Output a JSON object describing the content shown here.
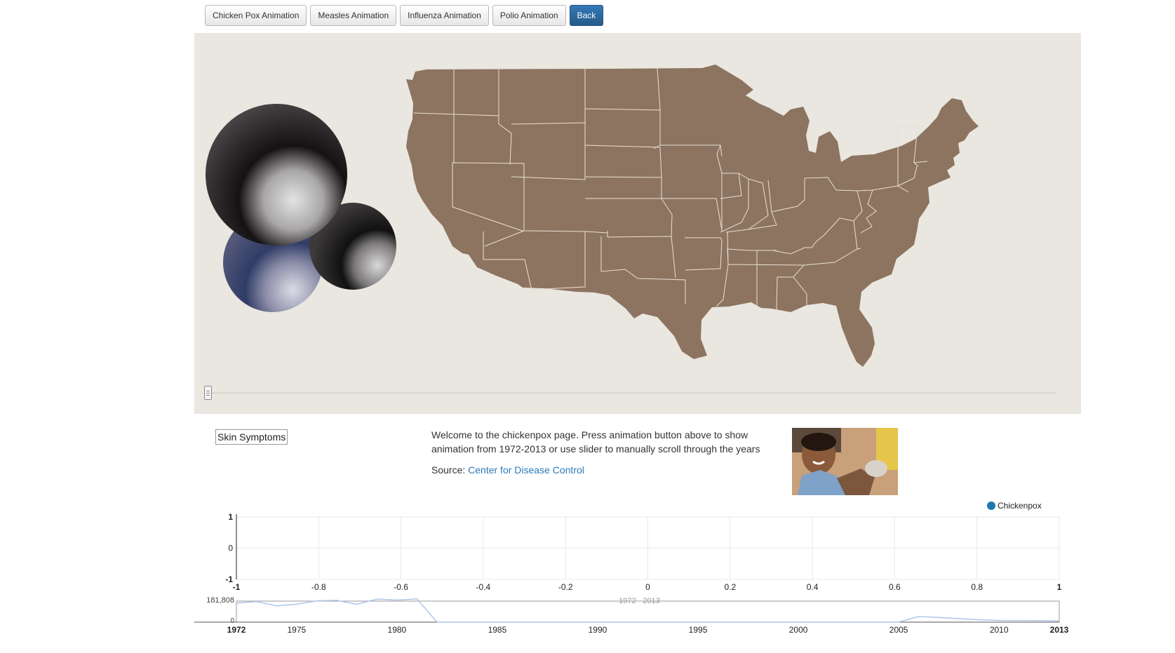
{
  "toolbar": {
    "buttons": [
      {
        "label": "Chicken Pox Animation"
      },
      {
        "label": "Measles Animation"
      },
      {
        "label": "Influenza Animation"
      },
      {
        "label": "Polio Animation"
      },
      {
        "label": "Back"
      }
    ]
  },
  "map": {
    "background": "#e9e7df",
    "land_color": "#8d7460",
    "border_color": "#e8e0d6",
    "slider_value": 0
  },
  "info": {
    "symptoms_button": "Skin Symptoms",
    "welcome_text": "Welcome to the chickenpox page. Press animation button above to show animation from 1972-2013 or use slider to manually scroll through the years",
    "source_label": "Source:",
    "source_link": "Center for Disease Control"
  },
  "chart_data": [
    {
      "type": "line",
      "legend": [
        "Chickenpox"
      ],
      "legend_color": "#1f77b4",
      "legend_position": "top-right",
      "x_ticks": [
        "-1",
        "-0.8",
        "-0.6",
        "-0.4",
        "-0.2",
        "0",
        "0.2",
        "0.4",
        "0.6",
        "0.8",
        "1"
      ],
      "y_ticks": [
        "1",
        "0",
        "-1"
      ],
      "xlim": [
        -1,
        1
      ],
      "ylim": [
        -1,
        1
      ],
      "grid": true,
      "series": [
        {
          "name": "Chickenpox",
          "x": [],
          "y": []
        }
      ]
    },
    {
      "type": "area",
      "role": "overview",
      "range_label": "1972 - 2013",
      "y_max_label": "181,808",
      "y_min_label": "0",
      "xlim": [
        1972,
        2013
      ],
      "x_ticks": [
        "1972",
        "1975",
        "1980",
        "1985",
        "1990",
        "1995",
        "2000",
        "2005",
        "2010",
        "2013"
      ],
      "ylim": [
        0,
        181808
      ],
      "series": [
        {
          "name": "Chickenpox",
          "x": [
            1972,
            1973,
            1974,
            1975,
            1976,
            1977,
            1978,
            1979,
            1980,
            1981,
            1982,
            1983,
            1984,
            1985,
            1986,
            1987,
            1988,
            1989,
            1990,
            1991,
            1992,
            1993,
            1994,
            1995,
            1996,
            1997,
            1998,
            1999,
            2000,
            2001,
            2002,
            2003,
            2004,
            2005,
            2006,
            2007,
            2008,
            2009,
            2010,
            2011,
            2012,
            2013
          ],
          "y": [
            164114,
            178162,
            141495,
            154248,
            183990,
            188396,
            154089,
            199081,
            190894,
            200766,
            0,
            0,
            0,
            0,
            0,
            0,
            0,
            0,
            0,
            0,
            0,
            0,
            0,
            0,
            0,
            0,
            0,
            0,
            0,
            0,
            0,
            0,
            0,
            0,
            48445,
            40146,
            30386,
            20480,
            15427,
            14513,
            13917,
            10888
          ]
        }
      ]
    }
  ]
}
